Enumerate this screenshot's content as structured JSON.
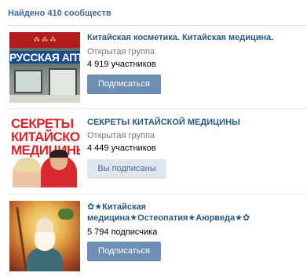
{
  "header": {
    "title": "Найдено 410 сообществ"
  },
  "communities": [
    {
      "name": "Китайская косметика. Китайская медицина.",
      "type": "Открытая группа",
      "count": "4 919 участников",
      "button": "Подписаться",
      "button_state": "subscribe",
      "thumb_text": "РУССКАЯ АПТ"
    },
    {
      "name": "СЕКРЕТЫ КИТАЙСКОЙ МЕДИЦИНЫ",
      "type": "Открытая группа",
      "count": "4 449 участников",
      "button": "Вы подписаны",
      "button_state": "subscribed",
      "thumb_lines": [
        "СЕКРЕТЫ",
        "КИТАЙСКОЙ",
        "МЕДИЦИНЫ"
      ]
    },
    {
      "name_line1": "✿★Китайская",
      "name_line2": "медицина★Остеопатия★Аюрведа★✿",
      "count": "5 794 подписчика",
      "button": "Подписаться",
      "button_state": "subscribe"
    }
  ],
  "colors": {
    "link": "#2b587a",
    "header": "#45688e",
    "button_primary": "#6d8fb3",
    "button_secondary": "#dfe6ed"
  }
}
